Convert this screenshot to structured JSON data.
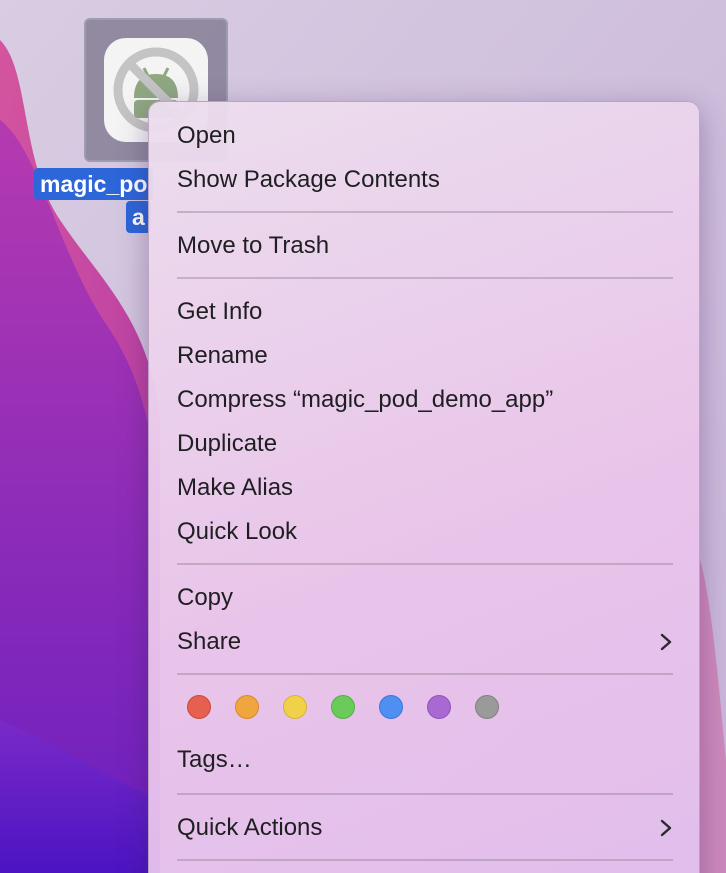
{
  "desktop_icon": {
    "label_line1": "magic_po",
    "label_line2": "a"
  },
  "menu": {
    "items": [
      {
        "label": "Open"
      },
      {
        "label": "Show Package Contents"
      },
      {
        "label": "Move to Trash"
      },
      {
        "label": "Get Info"
      },
      {
        "label": "Rename"
      },
      {
        "label": "Compress “magic_pod_demo_app”"
      },
      {
        "label": "Duplicate"
      },
      {
        "label": "Make Alias"
      },
      {
        "label": "Quick Look"
      },
      {
        "label": "Copy"
      },
      {
        "label": "Share"
      },
      {
        "label": "Tags…"
      },
      {
        "label": "Quick Actions"
      }
    ],
    "tag_colors": [
      {
        "name": "red",
        "color": "#e5604f",
        "border": "#c94a3c"
      },
      {
        "name": "orange",
        "color": "#f0a53e",
        "border": "#d68b2a"
      },
      {
        "name": "yellow",
        "color": "#f2d14a",
        "border": "#d4b436"
      },
      {
        "name": "green",
        "color": "#6acb5a",
        "border": "#52b043"
      },
      {
        "name": "blue",
        "color": "#4f8ff2",
        "border": "#3a77d6"
      },
      {
        "name": "purple",
        "color": "#a86ad2",
        "border": "#8f53b8"
      },
      {
        "name": "gray",
        "color": "#9a9a9a",
        "border": "#808080"
      }
    ]
  },
  "colors": {
    "selection_blue": "#2d66d8",
    "menu_text": "#1f1f22"
  }
}
